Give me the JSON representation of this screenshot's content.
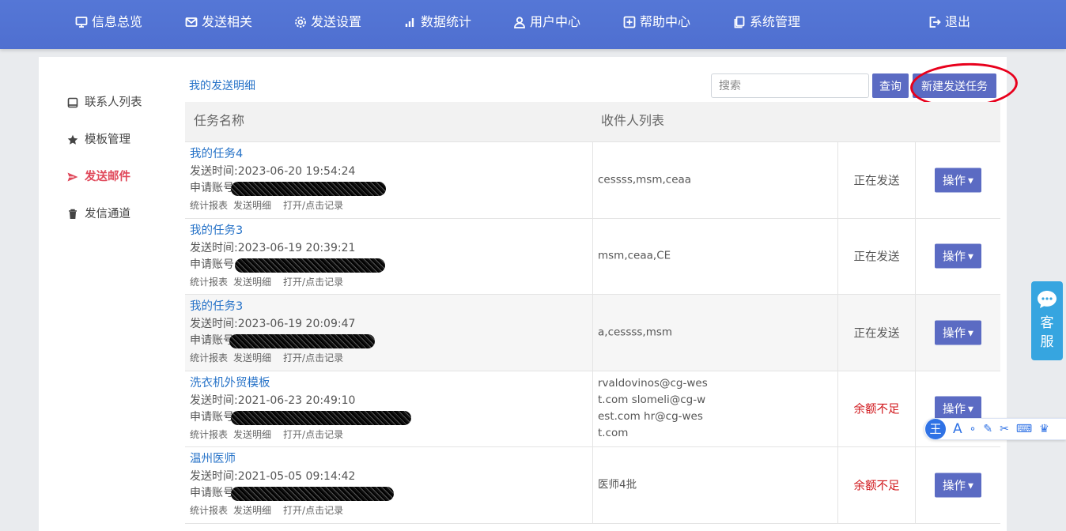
{
  "nav": {
    "items": [
      {
        "label": "信息总览",
        "icon": "monitor-icon"
      },
      {
        "label": "发送相关",
        "icon": "mail-icon"
      },
      {
        "label": "发送设置",
        "icon": "gear-icon"
      },
      {
        "label": "数据统计",
        "icon": "bar-chart-icon"
      },
      {
        "label": "用户中心",
        "icon": "user-icon"
      },
      {
        "label": "帮助中心",
        "icon": "help-icon"
      },
      {
        "label": "系统管理",
        "icon": "copy-icon"
      }
    ],
    "logout": {
      "label": "退出",
      "icon": "logout-icon"
    }
  },
  "sidebar": {
    "items": [
      {
        "label": "联系人列表",
        "icon": "contacts-icon"
      },
      {
        "label": "模板管理",
        "icon": "star-icon"
      },
      {
        "label": "发送邮件",
        "icon": "send-icon",
        "active": true
      },
      {
        "label": "发信通道",
        "icon": "trash-icon"
      }
    ]
  },
  "toolbar": {
    "breadcrumb": "我的发送明细",
    "search_placeholder": "搜索",
    "query_label": "查询",
    "new_task_label": "新建发送任务"
  },
  "table": {
    "headers": [
      "任务名称",
      "收件人列表"
    ],
    "link_labels": [
      "统计报表",
      "发送明细",
      "打开/点击记录"
    ],
    "op_label": "操作",
    "time_prefix": "发送时间:",
    "account_prefix": "申请账号",
    "rows": [
      {
        "name": "我的任务4",
        "time": "2023-06-20 19:54:24",
        "recipients": "cessss,msm,ceaa",
        "status": "正在发送"
      },
      {
        "name": "我的任务3",
        "time": "2023-06-19 20:39:21",
        "recipients": "msm,ceaa,CE",
        "status": "正在发送"
      },
      {
        "name": "我的任务3",
        "time": "2023-06-19 20:09:47",
        "recipients": "a,cessss,msm",
        "status": "正在发送"
      },
      {
        "name": "洗衣机外贸模板",
        "time": "2021-06-23 20:49:10",
        "recipients": "rvaldovinos@cg-west.com slomeli@cg-west.com hr@cg-west.com",
        "status": "余额不足"
      },
      {
        "name": "温州医师",
        "time": "2021-05-05 09:14:42",
        "recipients": "医师4批",
        "status": "余额不足"
      }
    ]
  },
  "widgets": {
    "kefu_chars": [
      "客",
      "服"
    ],
    "ime_logo": "王",
    "ime_letter": "A"
  },
  "colors": {
    "nav_bg": "#5273d3",
    "accent_button": "#5b6bc3",
    "link": "#2773c8",
    "active_side": "#e0495b",
    "warn": "#d0151a",
    "kefu": "#36a5e0"
  }
}
